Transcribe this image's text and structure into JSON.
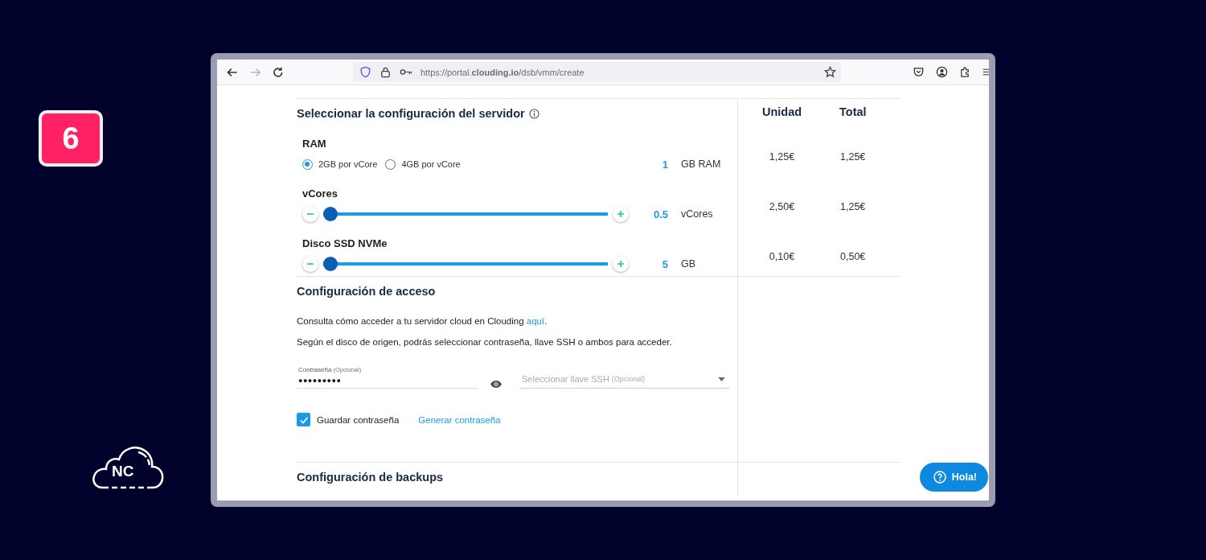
{
  "badge": {
    "text": "6"
  },
  "logo": {
    "text": "NC"
  },
  "browser": {
    "url": "https://portal.**clouding.io**/dsb/vmm/create",
    "forward_disabled": true
  },
  "server_config": {
    "title": "Seleccionar la configuración del servidor",
    "columns": [
      "Unidad",
      "Total"
    ],
    "resources": [
      {
        "kind": "radio",
        "label": "RAM",
        "options": [
          {
            "label": "2GB por vCore",
            "selected": true
          },
          {
            "label": "4GB por vCore",
            "selected": false
          }
        ],
        "quantity": "1",
        "unit": "GB RAM",
        "unit_price": "1,25€",
        "total": "1,25€"
      },
      {
        "kind": "slider",
        "label": "vCores",
        "level": 0,
        "quantity": "0.5",
        "unit": "vCores",
        "unit_price": "2,50€",
        "total": "1,25€"
      },
      {
        "kind": "slider",
        "label": "Disco SSD NVMe",
        "level": 0,
        "quantity": "5",
        "unit": "GB",
        "unit_price": "0,10€",
        "total": "0,50€"
      }
    ]
  },
  "access": {
    "title": "Configuración de acceso",
    "help_text": "Consulta cómo acceder a tu servidor cloud en Clouding ",
    "help_link": "aquí",
    "help_end": ".",
    "note": "Según el disco de origen, podrás seleccionar contraseña, llave SSH o ambos para acceder.",
    "password": {
      "label": "Contraseña",
      "hint": "(Opcional)",
      "value": "●●●●●●●●●"
    },
    "ssh_key": {
      "placeholder": "Seleccionar llave SSH",
      "hint": "(Opcional)"
    },
    "save_password": {
      "label": "Guardar contraseña",
      "checked": true
    },
    "generate_link": "Generar contraseña"
  },
  "backups": {
    "title": "Configuración de backups"
  },
  "help_button": {
    "label": "Hola!"
  }
}
